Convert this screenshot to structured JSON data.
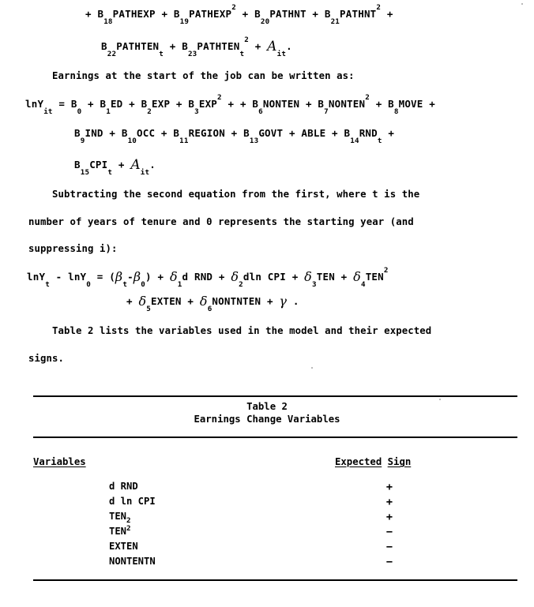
{
  "document": {
    "type": "scanned-typewritten-page",
    "equation_continuation": {
      "line1": "+ B<sub>18</sub>PATHEXP + B<sub>19</sub>PATHEXP<sup>2</sup> + B<sub>20</sub>PATHNT + B<sub>21</sub>PATHNT<sup>2</sup> +",
      "line2": "B<sub>22</sub>PATHTEN<sub>t</sub> + B<sub>23</sub>PATHTEN<sub>t</sub><sup>2</sup> + <span class=\"greek-mu\">&#119860;</span><sub>it</sub>."
    },
    "paragraph_1": "Earnings at the start of the job can be written as:",
    "equation_2": {
      "line1": "lnY<sub>it</sub> = B<sub>0</sub> + B<sub>1</sub>ED + B<sub>2</sub>EXP + B<sub>3</sub>EXP<sup>2</sup> + + B<sub>6</sub>NONTEN + B<sub>7</sub>NONTEN<sup>2</sup> + B<sub>8</sub>MOVE +",
      "line2": "B<sub>9</sub>IND + B<sub>10</sub>OCC + B<sub>11</sub>REGION + B<sub>13</sub>GOVT + ABLE + B<sub>14</sub>RND<sub>t</sub> +",
      "line3": "B<sub>15</sub>CPI<sub>t</sub> + <span class=\"greek-mu\">&#119860;</span><sub>it</sub>."
    },
    "paragraph_2": {
      "line1": "Subtracting the second equation from the first, where t is the",
      "line2": "number of years of tenure and 0 represents the starting year (and",
      "line3": "suppressing i):"
    },
    "equation_3": {
      "line1": "lnY<sub>t</sub> - lnY<sub>0</sub> = (<span class=\"greek\">&#946;</span><sub>t</sub>-<span class=\"greek\">&#946;</span><sub>0</sub>) + <span class=\"greek\">&#948;</span><sub>1</sub>d RND + <span class=\"greek\">&#948;</span><sub>2</sub>dln CPI + <span class=\"greek\">&#948;</span><sub>3</sub>TEN + <span class=\"greek\">&#948;</span><sub>4</sub>TEN<sup>2</sup>",
      "line2": "+ <span class=\"greek\">&#948;</span><sub>5</sub>EXTEN + <span class=\"greek\">&#948;</span><sub>6</sub>NONTNTEN + <span class=\"greek\">&#947;</span> ."
    },
    "paragraph_3": {
      "line1": "Table 2 lists the variables used in the model and their expected",
      "line2": "signs."
    }
  },
  "table": {
    "title_line1": "Table 2",
    "title_line2": "Earnings Change Variables",
    "columns": {
      "variables_header": "Variables",
      "sign_header_word1": "Expected",
      "sign_header_word2": "Sign"
    },
    "rows": [
      {
        "variable": "d RND",
        "variable_sup": "",
        "sign": "+"
      },
      {
        "variable": "d ln CPI",
        "variable_sup": "",
        "sign": "+"
      },
      {
        "variable": "TEN",
        "variable_sup": "2",
        "sign": "+"
      },
      {
        "variable": "TEN",
        "variable_sup": "2",
        "sign": "−"
      },
      {
        "variable": "EXTEN",
        "variable_sup": "",
        "sign": "−"
      },
      {
        "variable": "NONTENTN",
        "variable_sup": "",
        "sign": "−"
      }
    ]
  },
  "colors": {
    "ink": "#000000",
    "paper": "#ffffff"
  }
}
